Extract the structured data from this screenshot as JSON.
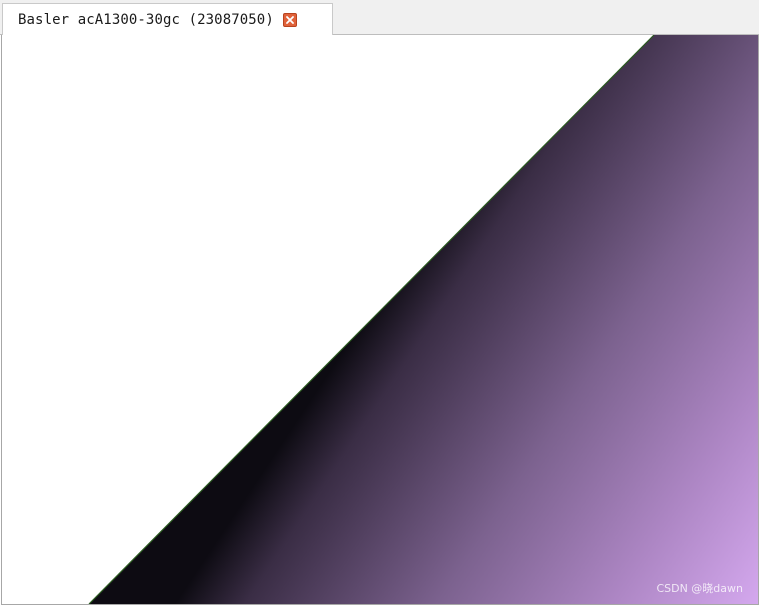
{
  "window": {
    "tab_title": "Basler acA1300-30gc (23087050)",
    "close_icon": "close-icon"
  },
  "image_view": {
    "content": "camera frame: diagonal edge, white upper-left region and dark-to-violet gradient lower-right region",
    "colors": {
      "edge_dark": "#0d0b12",
      "mid": "#6e5a7e",
      "light_violet": "#d4a8ee",
      "edge_line": "#2a5a1f"
    }
  },
  "watermark": {
    "text": "CSDN @晓dawn"
  }
}
